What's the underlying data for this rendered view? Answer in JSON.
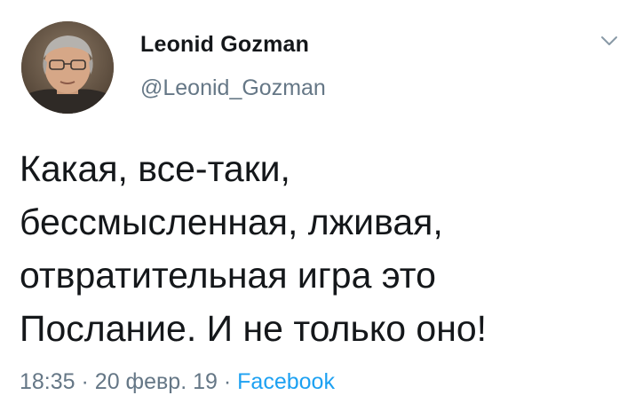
{
  "author": {
    "name": "Leonid Gozman",
    "handle": "@Leonid_Gozman"
  },
  "tweet": {
    "lines": [
      "Какая, все-таки,",
      "бессмысленная, лживая,",
      "отвратительная игра это",
      "Послание. И не только оно!"
    ]
  },
  "meta": {
    "time": "18:35",
    "separator": "·",
    "date": "20 февр. 19",
    "source": "Facebook"
  },
  "colors": {
    "text": "#14171a",
    "secondary": "#657786",
    "link": "#1da1f2"
  },
  "icons": {
    "menu": "chevron-down-icon"
  }
}
